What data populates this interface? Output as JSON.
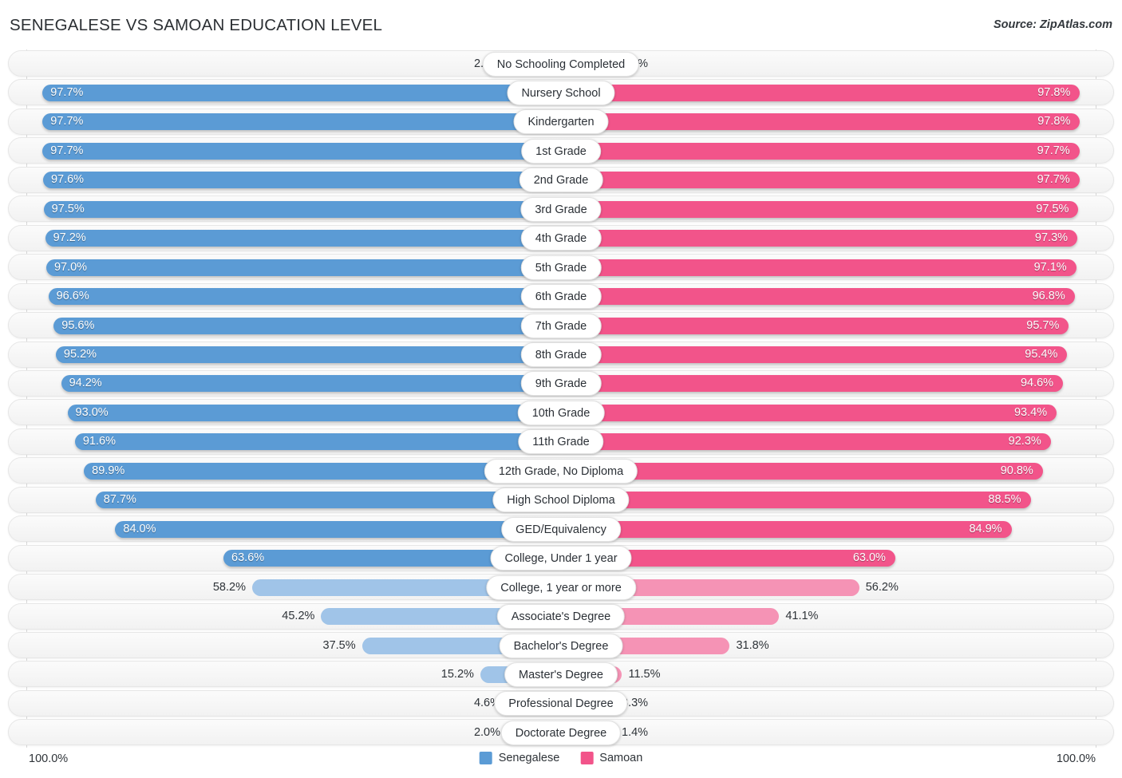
{
  "header": {
    "title": "SENEGALESE VS SAMOAN EDUCATION LEVEL",
    "source": "Source: ZipAtlas.com"
  },
  "footer": {
    "axis_min_label": "100.0%",
    "axis_max_label": "100.0%",
    "legend": [
      {
        "label": "Senegalese",
        "color": "#5B9BD5"
      },
      {
        "label": "Samoan",
        "color": "#F2548A"
      }
    ]
  },
  "colors": {
    "blue_strong": "#5B9BD5",
    "blue_light": "#A0C4E8",
    "pink_strong": "#F2548A",
    "pink_light": "#F593B5",
    "track": "#f5f5f5",
    "axis": "#d8d8d8"
  },
  "chart_data": {
    "type": "bar",
    "orientation": "horizontal-diverging",
    "title": "SENEGALESE VS SAMOAN EDUCATION LEVEL",
    "xlabel": "",
    "ylabel": "",
    "xlim": [
      0,
      100
    ],
    "grid": false,
    "legend_position": "bottom-center",
    "axis_min_label": "100.0%",
    "axis_max_label": "100.0%",
    "categories": [
      "No Schooling Completed",
      "Nursery School",
      "Kindergarten",
      "1st Grade",
      "2nd Grade",
      "3rd Grade",
      "4th Grade",
      "5th Grade",
      "6th Grade",
      "7th Grade",
      "8th Grade",
      "9th Grade",
      "10th Grade",
      "11th Grade",
      "12th Grade, No Diploma",
      "High School Diploma",
      "GED/Equivalency",
      "College, Under 1 year",
      "College, 1 year or more",
      "Associate's Degree",
      "Bachelor's Degree",
      "Master's Degree",
      "Professional Degree",
      "Doctorate Degree"
    ],
    "series": [
      {
        "name": "Senegalese",
        "side": "left",
        "color": "#5B9BD5",
        "values": [
          2.3,
          97.7,
          97.7,
          97.7,
          97.6,
          97.5,
          97.2,
          97.0,
          96.6,
          95.6,
          95.2,
          94.2,
          93.0,
          91.6,
          89.9,
          87.7,
          84.0,
          63.6,
          58.2,
          45.2,
          37.5,
          15.2,
          4.6,
          2.0
        ],
        "labels": [
          "2.3%",
          "97.7%",
          "97.7%",
          "97.7%",
          "97.6%",
          "97.5%",
          "97.2%",
          "97.0%",
          "96.6%",
          "95.6%",
          "95.2%",
          "94.2%",
          "93.0%",
          "91.6%",
          "89.9%",
          "87.7%",
          "84.0%",
          "63.6%",
          "58.2%",
          "45.2%",
          "37.5%",
          "15.2%",
          "4.6%",
          "2.0%"
        ]
      },
      {
        "name": "Samoan",
        "side": "right",
        "color": "#F2548A",
        "values": [
          2.3,
          97.8,
          97.8,
          97.7,
          97.7,
          97.5,
          97.3,
          97.1,
          96.8,
          95.7,
          95.4,
          94.6,
          93.4,
          92.3,
          90.8,
          88.5,
          84.9,
          63.0,
          56.2,
          41.1,
          31.8,
          11.5,
          3.3,
          1.4
        ],
        "labels": [
          "2.3%",
          "97.8%",
          "97.8%",
          "97.7%",
          "97.7%",
          "97.5%",
          "97.3%",
          "97.1%",
          "96.8%",
          "95.7%",
          "95.4%",
          "94.6%",
          "93.4%",
          "92.3%",
          "90.8%",
          "88.5%",
          "84.9%",
          "63.0%",
          "56.2%",
          "41.1%",
          "31.8%",
          "11.5%",
          "3.3%",
          "1.4%"
        ]
      }
    ]
  }
}
